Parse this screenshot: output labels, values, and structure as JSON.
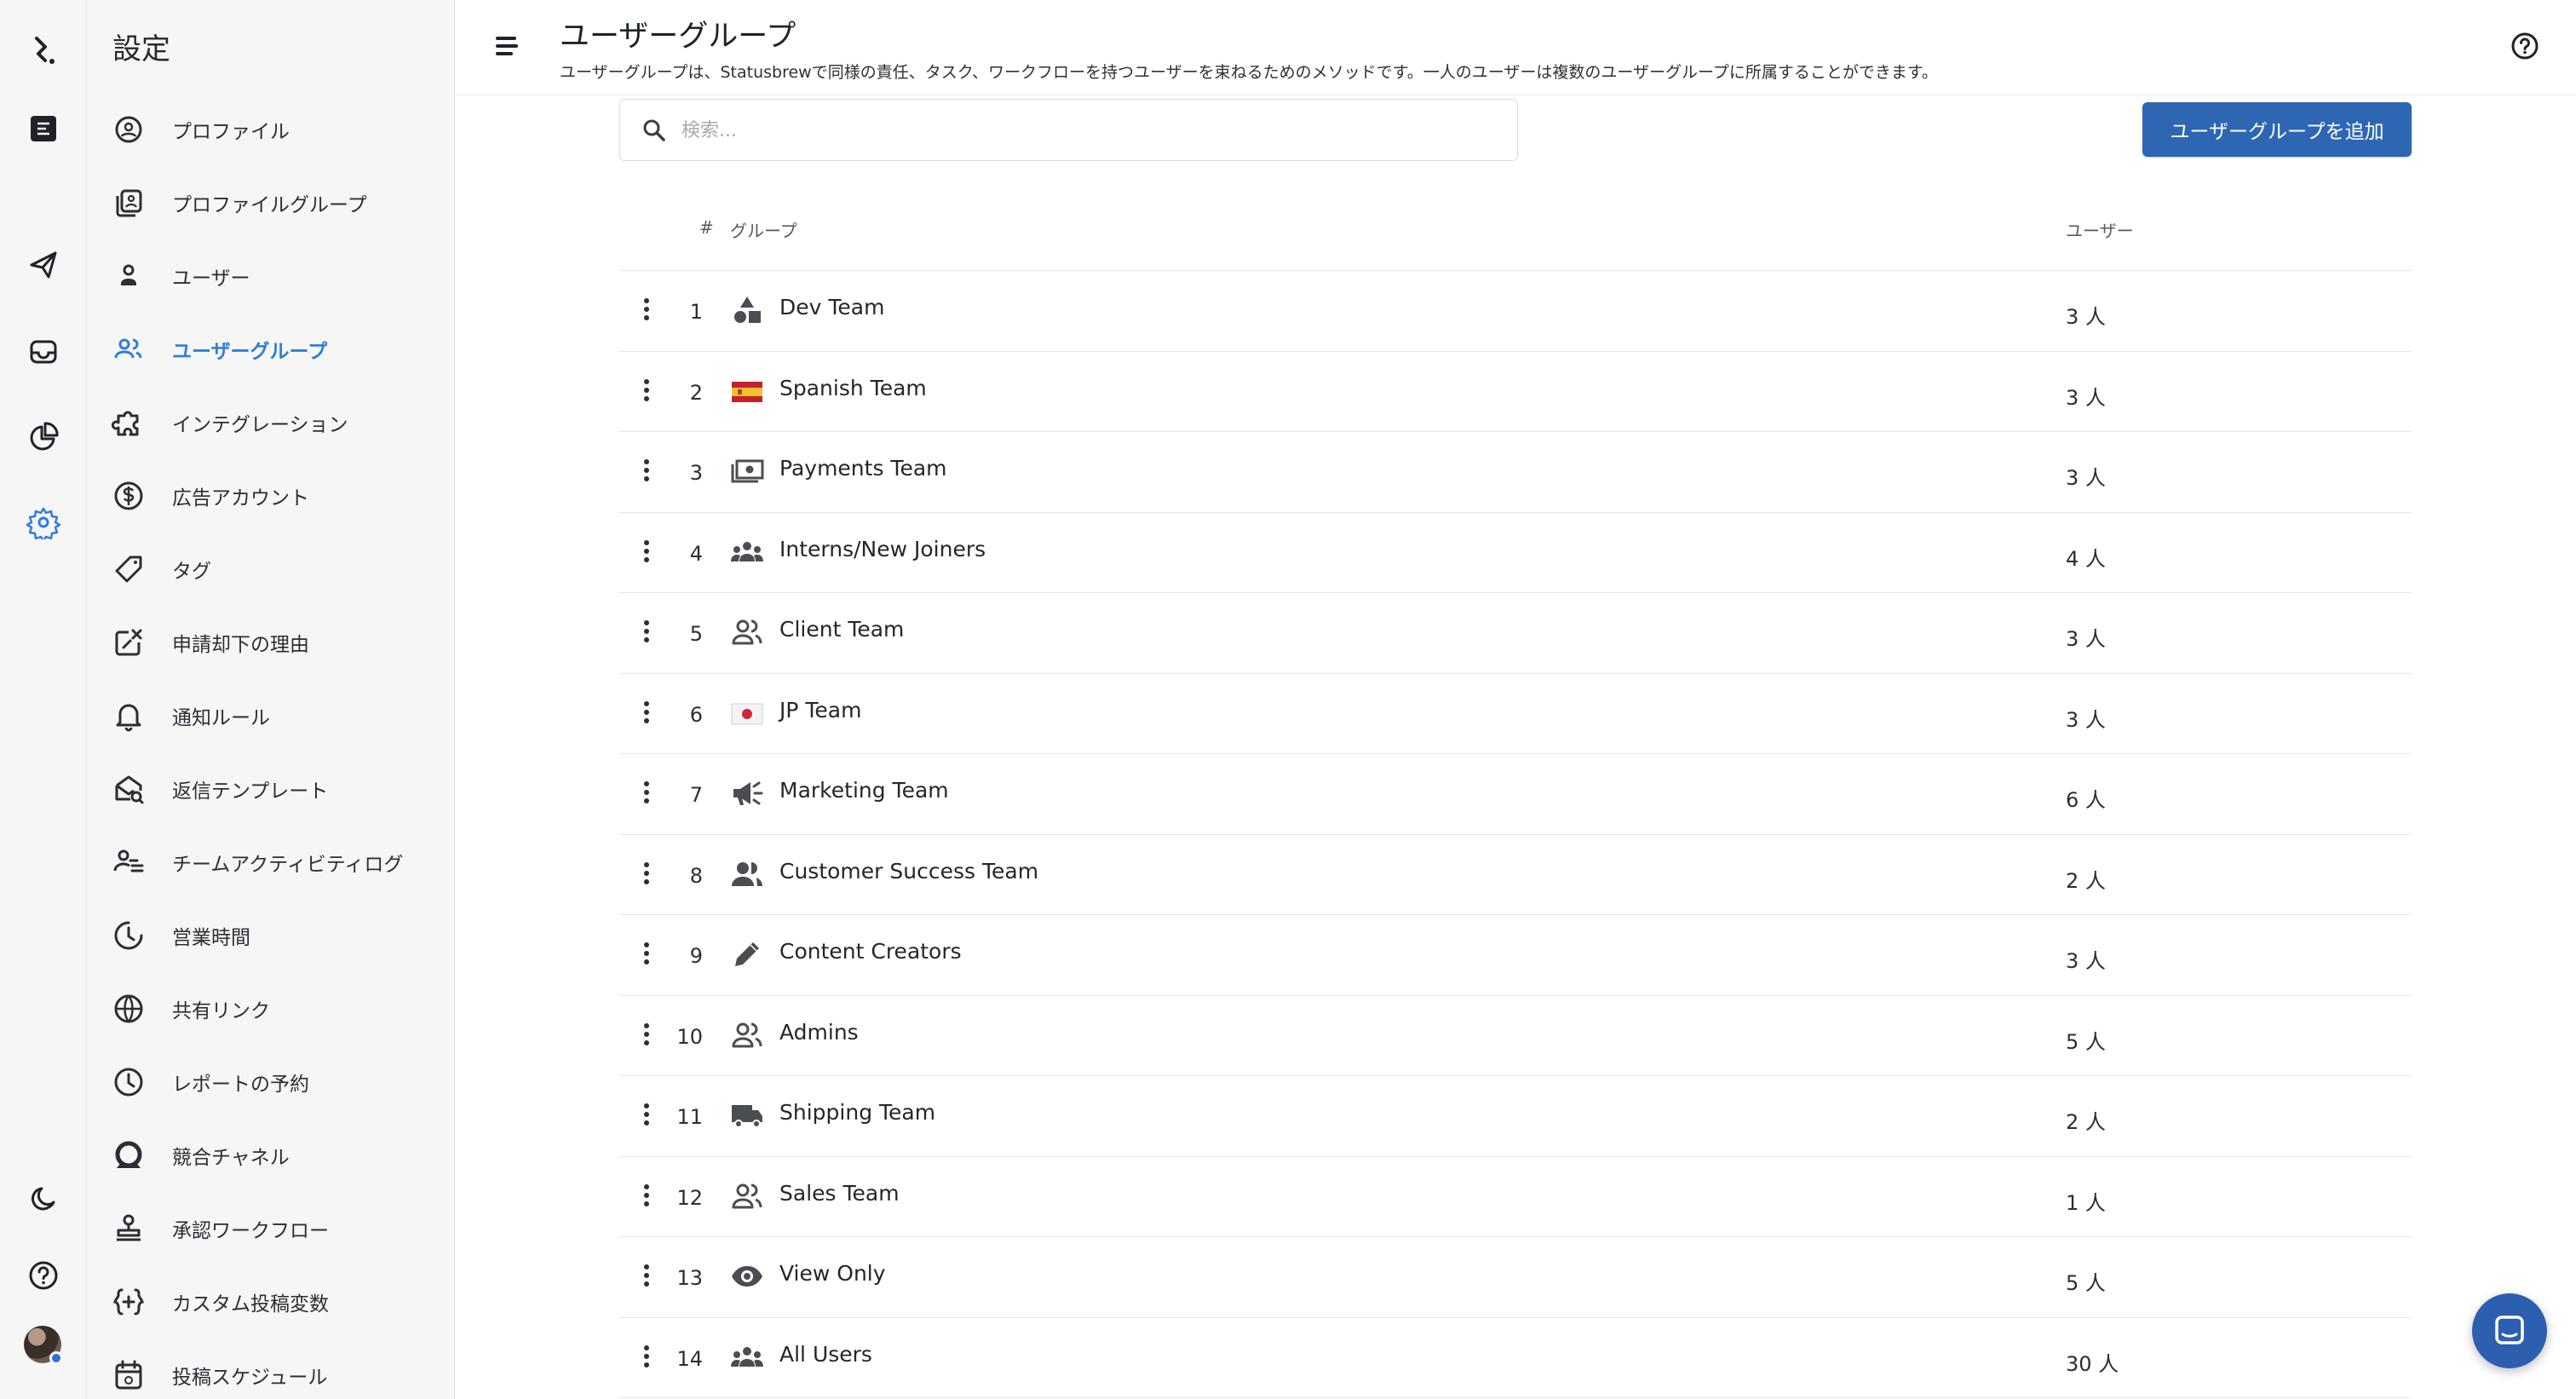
{
  "sidebar": {
    "title": "設定",
    "items": [
      {
        "label": "プロファイル",
        "icon": "profile-icon"
      },
      {
        "label": "プロファイルグループ",
        "icon": "profile-group-icon"
      },
      {
        "label": "ユーザー",
        "icon": "user-icon"
      },
      {
        "label": "ユーザーグループ",
        "icon": "user-group-icon",
        "active": true
      },
      {
        "label": "インテグレーション",
        "icon": "puzzle-icon"
      },
      {
        "label": "広告アカウント",
        "icon": "dollar-icon"
      },
      {
        "label": "タグ",
        "icon": "tag-icon"
      },
      {
        "label": "申請却下の理由",
        "icon": "reject-icon"
      },
      {
        "label": "通知ルール",
        "icon": "bell-icon"
      },
      {
        "label": "返信テンプレート",
        "icon": "mail-template-icon"
      },
      {
        "label": "チームアクティビティログ",
        "icon": "activity-log-icon"
      },
      {
        "label": "営業時間",
        "icon": "business-hours-icon"
      },
      {
        "label": "共有リンク",
        "icon": "globe-icon"
      },
      {
        "label": "レポートの予約",
        "icon": "clock-icon"
      },
      {
        "label": "競合チャネル",
        "icon": "competitor-icon"
      },
      {
        "label": "承認ワークフロー",
        "icon": "stamp-icon"
      },
      {
        "label": "カスタム投稿変数",
        "icon": "variable-icon"
      },
      {
        "label": "投稿スケジュール",
        "icon": "calendar-icon"
      }
    ]
  },
  "header": {
    "title": "ユーザーグループ",
    "description": "ユーザーグループは、Statusbrewで同様の責任、タスク、ワークフローを持つユーザーを束ねるためのメソッドです。一人のユーザーは複数のユーザーグループに所属することができます。"
  },
  "search": {
    "placeholder": "検索..."
  },
  "add_button": {
    "label": "ユーザーグループを追加"
  },
  "table": {
    "columns": {
      "num": "#",
      "group": "グループ",
      "users": "ユーザー"
    },
    "rows": [
      {
        "num": "1",
        "name": "Dev Team",
        "users": "3 人",
        "icon": "shapes-icon"
      },
      {
        "num": "2",
        "name": "Spanish Team",
        "users": "3 人",
        "icon": "spain-flag-icon"
      },
      {
        "num": "3",
        "name": "Payments Team",
        "users": "3 人",
        "icon": "money-icon"
      },
      {
        "num": "4",
        "name": "Interns/New Joiners",
        "users": "4 人",
        "icon": "group-icon"
      },
      {
        "num": "5",
        "name": "Client Team",
        "users": "3 人",
        "icon": "people-outline-icon"
      },
      {
        "num": "6",
        "name": "JP Team",
        "users": "3 人",
        "icon": "japan-flag-icon"
      },
      {
        "num": "7",
        "name": "Marketing Team",
        "users": "6 人",
        "icon": "megaphone-icon"
      },
      {
        "num": "8",
        "name": "Customer Success Team",
        "users": "2 人",
        "icon": "people-icon"
      },
      {
        "num": "9",
        "name": "Content Creators",
        "users": "3 人",
        "icon": "pencil-icon"
      },
      {
        "num": "10",
        "name": "Admins",
        "users": "5 人",
        "icon": "people-outline-icon"
      },
      {
        "num": "11",
        "name": "Shipping Team",
        "users": "2 人",
        "icon": "truck-icon"
      },
      {
        "num": "12",
        "name": "Sales Team",
        "users": "1 人",
        "icon": "people-outline-icon"
      },
      {
        "num": "13",
        "name": "View Only",
        "users": "5 人",
        "icon": "eye-icon"
      },
      {
        "num": "14",
        "name": "All Users",
        "users": "30 人",
        "icon": "group-icon"
      }
    ]
  },
  "colors": {
    "accent": "#2f7ddd",
    "primary_button": "#2d67b3",
    "chat_button": "#2d5fb0"
  }
}
